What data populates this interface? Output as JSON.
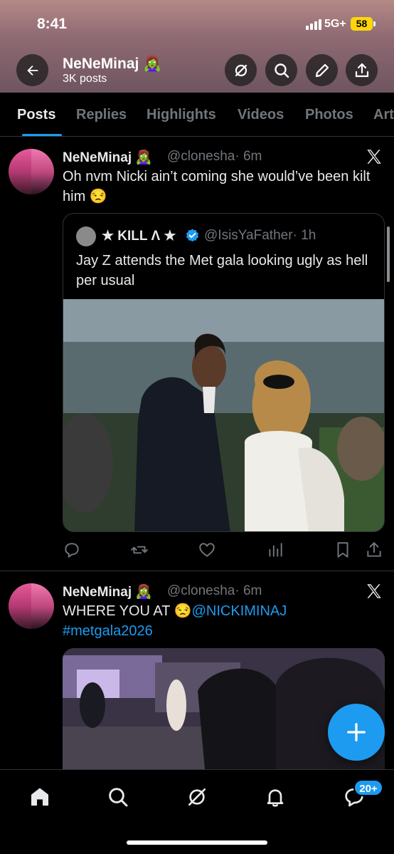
{
  "status_bar": {
    "time": "8:41",
    "network": "5G+",
    "battery": "58"
  },
  "header": {
    "title": "NeNeMinaj",
    "title_emoji": "🧟‍♀️",
    "subtitle": "3K posts"
  },
  "tabs": [
    "Posts",
    "Replies",
    "Highlights",
    "Videos",
    "Photos",
    "Art"
  ],
  "posts": [
    {
      "name": "NeNeMinaj",
      "name_emoji": "🧟‍♀️",
      "handle": "@clonesha",
      "time": "· 6m",
      "text": "Oh nvm Nicki ain’t coming she would’ve been kilt him 😒",
      "quote": {
        "name": "★ KILL Λ ★",
        "handle": "@IsisYaFather",
        "time": "· 1h",
        "text": "Jay Z attends the Met gala looking ugly as hell per usual"
      }
    },
    {
      "name": "NeNeMinaj",
      "name_emoji": "🧟‍♀️",
      "handle": "@clonesha",
      "time": "· 6m",
      "text_prefix": "WHERE YOU AT 😒",
      "mention": "@NICKIMINAJ",
      "hashtag": "#metgala2026"
    }
  ],
  "bottom_nav": {
    "badge": "20+"
  },
  "colors": {
    "accent": "#1d9bf0",
    "background": "#000000",
    "muted": "#71767b",
    "battery": "#ffd60a"
  }
}
